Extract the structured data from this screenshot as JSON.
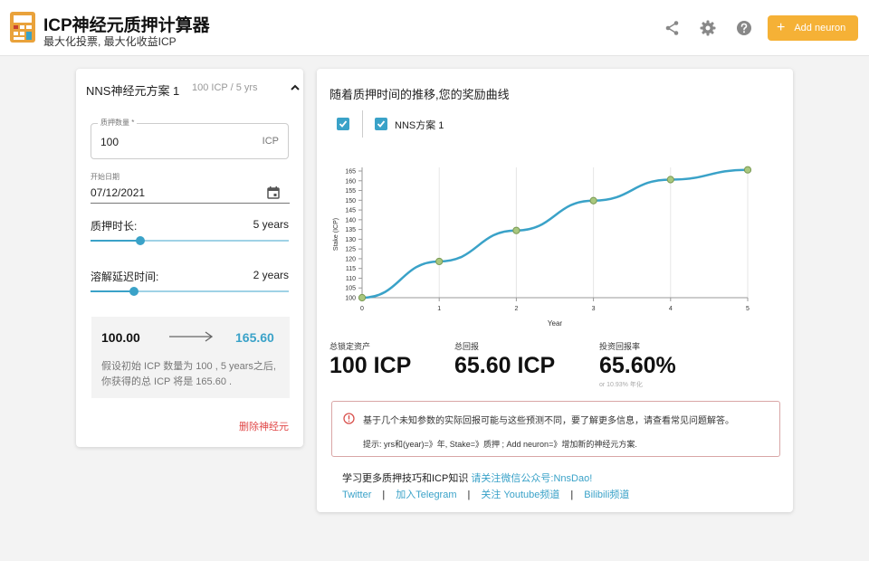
{
  "header": {
    "title": "ICP神经元质押计算器",
    "subtitle": "最大化投票, 最大化收益ICP",
    "add_button_label": "Add neuron",
    "icons": [
      "share-icon",
      "gear-icon",
      "help-icon"
    ]
  },
  "neuron_panel": {
    "title": "NNS神经元方案 1",
    "summary": "100 ICP / 5 yrs",
    "stake_label": "质押数量 *",
    "stake_value": "100",
    "stake_unit": "ICP",
    "start_date_label": "开始日期",
    "start_date_value": "07/12/2021",
    "lock_label": "质押时长:",
    "lock_value": "5 years",
    "lock_level": 0.25,
    "dissolve_label": "溶解延迟时间:",
    "dissolve_value": "2 years",
    "dissolve_level": 0.22,
    "calc_from": "100.00",
    "calc_to": "165.60",
    "calc_note": "假设初始 ICP 数量为 100 , 5 years之后,你获得的总 ICP 将是 165.60 .",
    "delete_label": "删除神经元"
  },
  "chart_panel": {
    "title": "随着质押时间的推移,您的奖励曲线",
    "series_checkbox_label": "NNS方案 1",
    "stats": {
      "locked_label": "总锁定资产",
      "locked_value": "100 ICP",
      "return_label": "总回报",
      "return_value": "65.60 ICP",
      "roi_label": "投资回报率",
      "roi_value": "65.60%",
      "roi_sub": "or 10.93% 年化"
    },
    "info_line1": "基于几个未知参数的实际回报可能与这些预测不同，要了解更多信息，请查看常见问题解答。",
    "info_line2": "提示: yrs和(year)=》年, Stake=》质押 ; Add neuron=》增加新的神经元方案.",
    "learn_prefix": "学习更多质押技巧和ICP知识 ",
    "learn_highlight": "请关注微信公众号:NnsDao!",
    "links": [
      "Twitter",
      "加入Telegram",
      "关注 Youtube频道",
      "Bilibili频道"
    ]
  },
  "chart_data": {
    "type": "line",
    "x": [
      0,
      1,
      2,
      3,
      4,
      5
    ],
    "series": [
      {
        "values": [
          100,
          118.6,
          134.5,
          149.8,
          160.6,
          165.6
        ]
      }
    ],
    "xlabel": "Year",
    "ylabel": "Stake (ICP)",
    "xlim": [
      0,
      5
    ],
    "ylim": [
      100,
      165
    ],
    "yticks": [
      "100",
      "105",
      "110",
      "115",
      "120",
      "125",
      "130",
      "135",
      "140",
      "145",
      "150",
      "155",
      "160",
      "165"
    ],
    "xticks": [
      "0",
      "1",
      "2",
      "3",
      "4",
      "5"
    ],
    "grid": "vertical",
    "colors": {
      "line": "#3aa2c8",
      "marker": "#a9c77e"
    }
  }
}
